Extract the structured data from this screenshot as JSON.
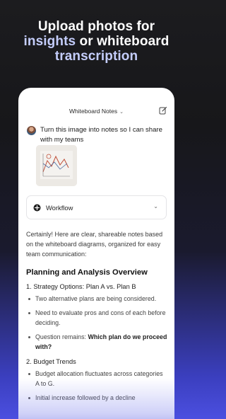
{
  "promo": {
    "line1": "Upload photos for",
    "line2_highlight": "insights",
    "line2_rest": " or whiteboard",
    "line3": "transcription"
  },
  "header": {
    "title": "Whiteboard Notes",
    "title_chevron": "chevron-down-icon",
    "edit_icon": "edit-icon"
  },
  "user_message": {
    "text": "Turn this image into notes so I can share with my teams",
    "attachment": "whiteboard-photo"
  },
  "workflow": {
    "label": "Workflow",
    "icon": "workflow-icon"
  },
  "response": {
    "intro": "Certainly! Here are clear, shareable notes based on the whiteboard diagrams, organized for easy team communication:",
    "heading": "Planning and Analysis Overview",
    "sections": [
      {
        "title": "1. Strategy Options: Plan A vs. Plan B",
        "bullets": [
          "Two alternative plans are being considered.",
          "Need to evaluate pros and cons of each before deciding.",
          "Question remains: "
        ],
        "bold_tail": "Which plan do we proceed with?"
      },
      {
        "title": "2. Budget Trends",
        "bullets": [
          "Budget allocation fluctuates across categories A to G.",
          "Initial increase followed by a decline"
        ]
      }
    ]
  },
  "colors": {
    "accent": "#c4cdfb",
    "background_top": "#1c1c1f",
    "background_bottom": "#4b4fe0"
  }
}
